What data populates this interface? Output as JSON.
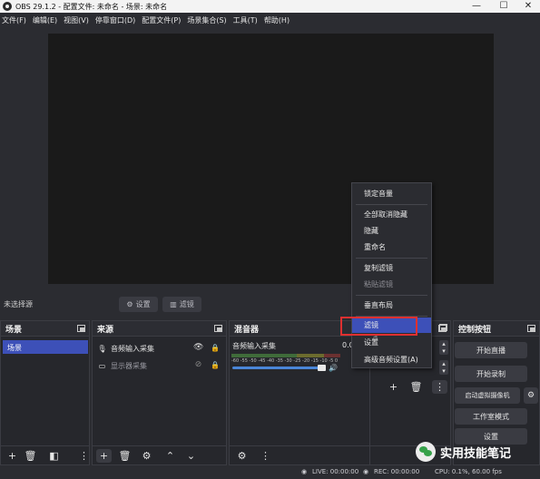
{
  "window": {
    "title": "OBS 29.1.2 - 配置文件: 未命名 - 场景: 未命名",
    "controls": [
      "—",
      "☐",
      "✕"
    ]
  },
  "menubar": [
    "文件(F)",
    "编辑(E)",
    "视图(V)",
    "停靠窗口(D)",
    "配置文件(P)",
    "场景集合(S)",
    "工具(T)",
    "帮助(H)"
  ],
  "source_bar": {
    "no_selection": "未选择源",
    "properties_label": "设置",
    "filters_label": "滤镜"
  },
  "docks": {
    "scenes": {
      "title": "场景",
      "items": [
        "场景"
      ]
    },
    "sources": {
      "title": "来源",
      "items": [
        {
          "label": "音频输入采集",
          "icon": "microphone-icon",
          "visible": true,
          "enabled": true
        },
        {
          "label": "显示器采集",
          "icon": "monitor-icon",
          "visible": false,
          "enabled": false
        }
      ]
    },
    "mixer": {
      "title": "混音器",
      "channel": "音频输入采集",
      "level": "0.0",
      "ticks": "-60 -55 -50 -45 -40 -35 -30 -25 -20 -15 -10 -5 0",
      "volume_fraction": 0.92
    },
    "controls": {
      "title": "控制按钮",
      "buttons": [
        "开始直播",
        "开始录制",
        "启动虚拟摄像机",
        "工作室模式",
        "设置"
      ]
    }
  },
  "context_menu": {
    "items": [
      {
        "label": "锁定音量",
        "disabled": false
      },
      {
        "label": "全部取消隐藏",
        "disabled": false
      },
      {
        "label": "隐藏",
        "disabled": false
      },
      {
        "label": "重命名",
        "disabled": false
      },
      {
        "label": "复制滤镜",
        "disabled": false
      },
      {
        "label": "粘贴滤镜",
        "disabled": true
      },
      {
        "label": "垂直布局",
        "disabled": false
      },
      {
        "label": "滤镜",
        "disabled": false,
        "highlighted": true
      },
      {
        "label": "设置",
        "disabled": false
      },
      {
        "label": "高级音频设置(A)",
        "disabled": false
      }
    ]
  },
  "status": {
    "live": "LIVE: 00:00:00",
    "rec": "REC: 00:00:00",
    "cpu": "CPU: 0.1%, 60.00 fps"
  },
  "watermark": {
    "text": "实用技能笔记"
  },
  "colors": {
    "accent": "#3d50b8",
    "highlight_box": "#e03030",
    "background": "#2b2c31"
  }
}
